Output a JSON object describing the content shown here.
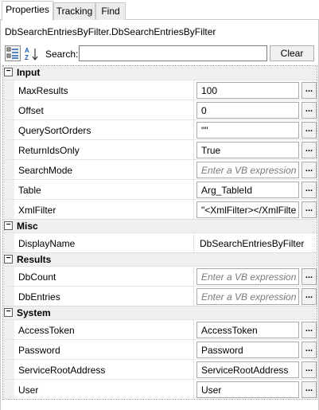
{
  "tabs": [
    {
      "label": "Properties"
    },
    {
      "label": "Tracking"
    },
    {
      "label": "Find"
    }
  ],
  "object_name": "DbSearchEntriesByFilter.DbSearchEntriesByFilter",
  "toolbar": {
    "search_label": "Search:",
    "search_value": "",
    "clear_label": "Clear"
  },
  "categories": {
    "input": "Input",
    "misc": "Misc",
    "results": "Results",
    "system": "System"
  },
  "expander_glyph": "−",
  "ellipsis": "...",
  "props": {
    "max_results": {
      "name": "MaxResults",
      "value": "100"
    },
    "offset": {
      "name": "Offset",
      "value": "0"
    },
    "query_sort_orders": {
      "name": "QuerySortOrders",
      "value": "\"\""
    },
    "return_ids_only": {
      "name": "ReturnIdsOnly",
      "value": "True"
    },
    "search_mode": {
      "name": "SearchMode",
      "value": "Enter a VB expression"
    },
    "table": {
      "name": "Table",
      "value": "Arg_TableId"
    },
    "xml_filter": {
      "name": "XmlFilter",
      "value": "\"<XmlFilter></XmlFilte"
    },
    "display_name": {
      "name": "DisplayName",
      "value": "DbSearchEntriesByFilter"
    },
    "db_count": {
      "name": "DbCount",
      "value": "Enter a VB expression"
    },
    "db_entries": {
      "name": "DbEntries",
      "value": "Enter a VB expression"
    },
    "access_token": {
      "name": "AccessToken",
      "value": "AccessToken"
    },
    "password": {
      "name": "Password",
      "value": "Password"
    },
    "service_root_address": {
      "name": "ServiceRootAddress",
      "value": "ServiceRootAddress"
    },
    "user": {
      "name": "User",
      "value": "User"
    }
  },
  "colors": {
    "category_bg": "#f0f0f0",
    "placeholder_text": "#7a7a7a",
    "sort_icon_blue": "#1f5fb0"
  }
}
